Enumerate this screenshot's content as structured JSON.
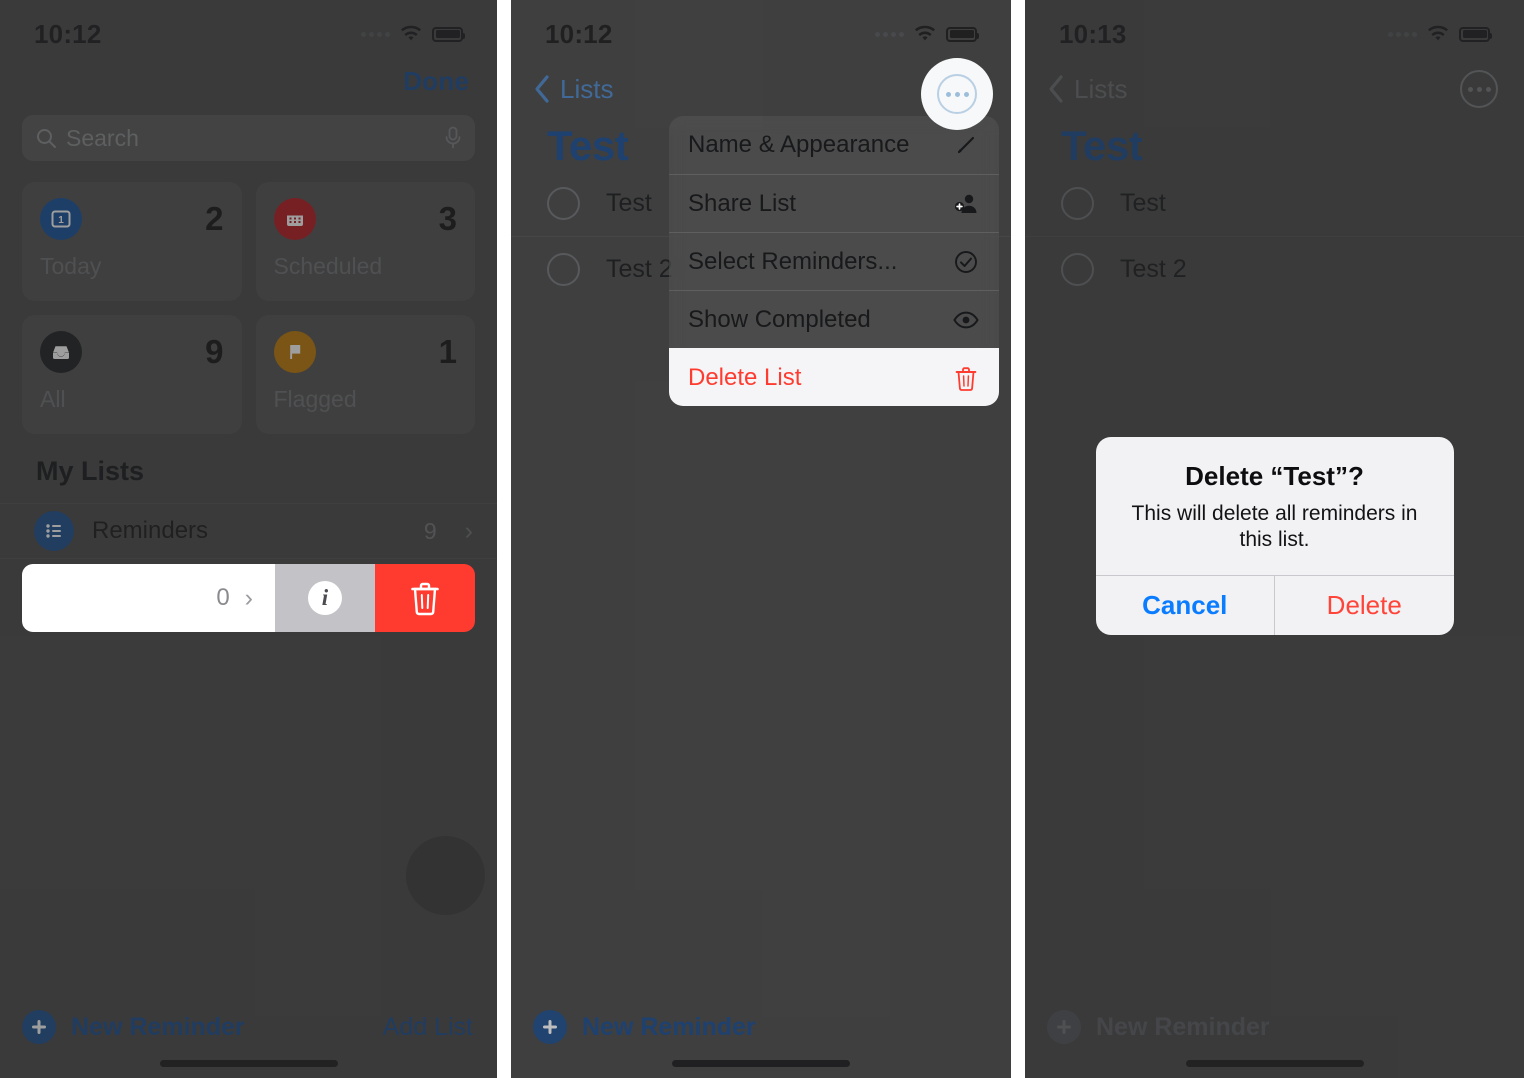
{
  "panels": [
    {
      "status": {
        "time": "10:12"
      },
      "topbar": {
        "done_label": "Done"
      },
      "search": {
        "placeholder": "Search"
      },
      "tiles": [
        {
          "label": "Today",
          "count": "2",
          "color": "#15509b",
          "icon": "today-calendar-icon"
        },
        {
          "label": "Scheduled",
          "count": "3",
          "color": "#b61b22",
          "icon": "scheduled-calendar-icon"
        },
        {
          "label": "All",
          "count": "9",
          "color": "#1e1f22",
          "icon": "all-inbox-icon"
        },
        {
          "label": "Flagged",
          "count": "1",
          "color": "#c07a09",
          "icon": "flag-icon"
        }
      ],
      "my_lists": {
        "header": "My Lists",
        "rows": [
          {
            "name": "Reminders",
            "count": "9",
            "icon": "list-bullet-icon"
          }
        ]
      },
      "swipe_row": {
        "count": "0",
        "info_glyph": "i",
        "delete_icon": "trash-icon"
      },
      "bottom": {
        "new_reminder": "New Reminder",
        "add_list": "Add List"
      }
    },
    {
      "status": {
        "time": "10:12"
      },
      "nav": {
        "back_label": "Lists",
        "more_icon": "ellipsis-circle-icon"
      },
      "title": "Test",
      "reminders": [
        "Test",
        "Test 2"
      ],
      "menu": [
        {
          "label": "Name & Appearance",
          "icon": "pencil-icon",
          "destructive": false
        },
        {
          "label": "Share List",
          "icon": "person-add-icon",
          "destructive": false
        },
        {
          "label": "Select Reminders...",
          "icon": "checkmark-circle-icon",
          "destructive": false
        },
        {
          "label": "Show Completed",
          "icon": "eye-icon",
          "destructive": false
        },
        {
          "label": "Delete List",
          "icon": "trash-icon",
          "destructive": true
        }
      ],
      "bottom": {
        "new_reminder": "New Reminder"
      }
    },
    {
      "status": {
        "time": "10:13"
      },
      "nav": {
        "back_label": "Lists",
        "more_icon": "ellipsis-circle-icon"
      },
      "title": "Test",
      "reminders": [
        "Test",
        "Test 2"
      ],
      "alert": {
        "title": "Delete “Test”?",
        "message": "This will delete all reminders in this list.",
        "cancel": "Cancel",
        "confirm": "Delete"
      },
      "bottom": {
        "new_reminder": "New Reminder"
      }
    }
  ],
  "colors": {
    "accent_blue": "#1a4d8f",
    "destructive_red": "#ff3b30",
    "alert_blue": "#0a7cff",
    "panel_bg": "#4a4a4a"
  }
}
